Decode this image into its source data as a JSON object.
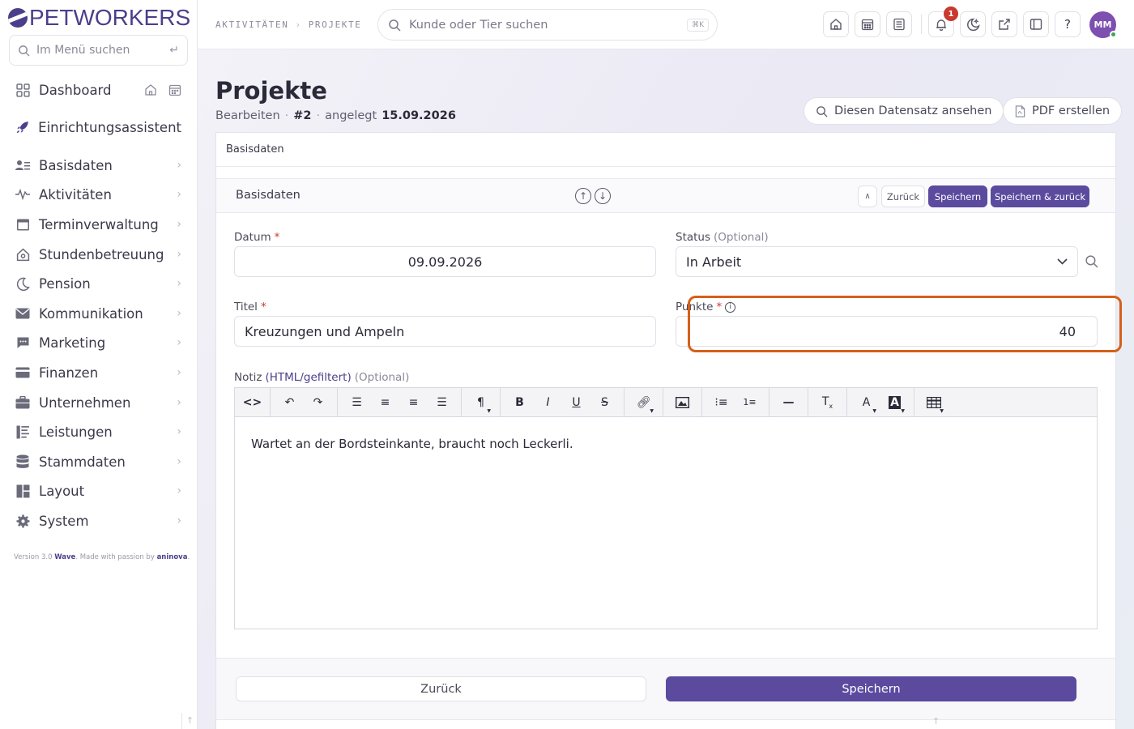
{
  "brand": {
    "name": "PETWORKERS",
    "accent": "#5b4a9e",
    "highlight": "#d4601a"
  },
  "sidebar": {
    "search_placeholder": "Im Menü suchen",
    "items": [
      {
        "label": "Dashboard",
        "icon": "grid-icon"
      },
      {
        "label": "Einrichtungsassistent",
        "icon": "rocket-icon"
      },
      {
        "label": "Basisdaten",
        "icon": "list-user-icon"
      },
      {
        "label": "Aktivitäten",
        "icon": "activity-icon"
      },
      {
        "label": "Terminverwaltung",
        "icon": "calendar-icon"
      },
      {
        "label": "Stundenbetreuung",
        "icon": "house-icon"
      },
      {
        "label": "Pension",
        "icon": "moon-icon"
      },
      {
        "label": "Kommunikation",
        "icon": "envelope-icon"
      },
      {
        "label": "Marketing",
        "icon": "chat-icon"
      },
      {
        "label": "Finanzen",
        "icon": "card-icon"
      },
      {
        "label": "Unternehmen",
        "icon": "briefcase-icon"
      },
      {
        "label": "Leistungen",
        "icon": "list-icon"
      },
      {
        "label": "Stammdaten",
        "icon": "database-icon"
      },
      {
        "label": "Layout",
        "icon": "layout-icon"
      },
      {
        "label": "System",
        "icon": "gear-icon"
      }
    ],
    "version": {
      "prefix": "Version 3.0",
      "product": "Wave",
      "middle": ". Made with passion by",
      "company": "aninova",
      "suffix": "."
    }
  },
  "topbar": {
    "breadcrumb": [
      "AKTIVITÄTEN",
      "PROJEKTE"
    ],
    "search_placeholder": "Kunde oder Tier suchen",
    "search_shortcut": "⌘K",
    "notification_count": "1",
    "avatar_initials": "MM",
    "help_label": "?"
  },
  "page": {
    "title": "Projekte",
    "subtitle": {
      "action": "Bearbeiten",
      "id": "#2",
      "created_label": "angelegt",
      "created_date": "15.09.2026"
    },
    "view_button": "Diesen Datensatz ansehen",
    "pdf_button": "PDF erstellen"
  },
  "form": {
    "card_title": "Basisdaten",
    "section_title": "Basisdaten",
    "back_label": "Zurück",
    "save_label": "Speichern",
    "save_back_label": "Speichern & zurück",
    "fields": {
      "datum": {
        "label": "Datum",
        "value": "09.09.2026"
      },
      "status": {
        "label": "Status",
        "optional": "(Optional)",
        "value": "In Arbeit"
      },
      "titel": {
        "label": "Titel",
        "value": "Kreuzungen und Ampeln"
      },
      "punkte": {
        "label": "Punkte",
        "value": "40"
      },
      "notiz": {
        "label": "Notiz",
        "format": "(HTML/gefiltert)",
        "optional": "(Optional)",
        "value": "Wartet an der Bordsteinkante, braucht noch Leckerli."
      }
    },
    "required_mark": "*",
    "footer_back": "Zurück",
    "footer_save": "Speichern"
  }
}
